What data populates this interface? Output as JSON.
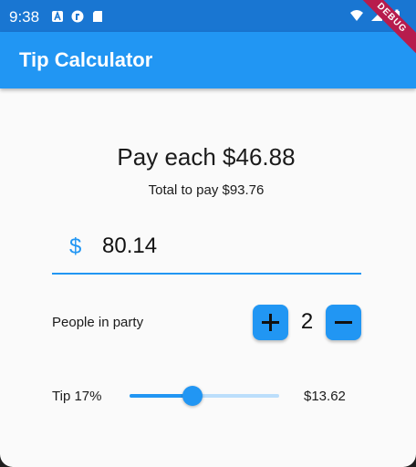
{
  "status_bar": {
    "time": "9:38",
    "left_icons": [
      "a-notification-icon",
      "flutter-notification-icon",
      "sd-card-icon"
    ],
    "right_icons": [
      "wifi-icon",
      "signal-icon",
      "battery-icon"
    ]
  },
  "debug_banner": {
    "label": "DEBUG"
  },
  "app_bar": {
    "title": "Tip Calculator"
  },
  "summary": {
    "pay_each": "Pay each $46.88",
    "total": "Total to pay $93.76"
  },
  "bill": {
    "prefix": "$",
    "value": "80.14"
  },
  "party": {
    "label": "People in party",
    "count": "2"
  },
  "tip": {
    "label": "Tip 17%",
    "amount": "$13.62",
    "slider_fraction": 0.42
  },
  "colors": {
    "primary": "#2196f3",
    "status_bar": "#1976d2",
    "debug": "#b71c4d"
  }
}
